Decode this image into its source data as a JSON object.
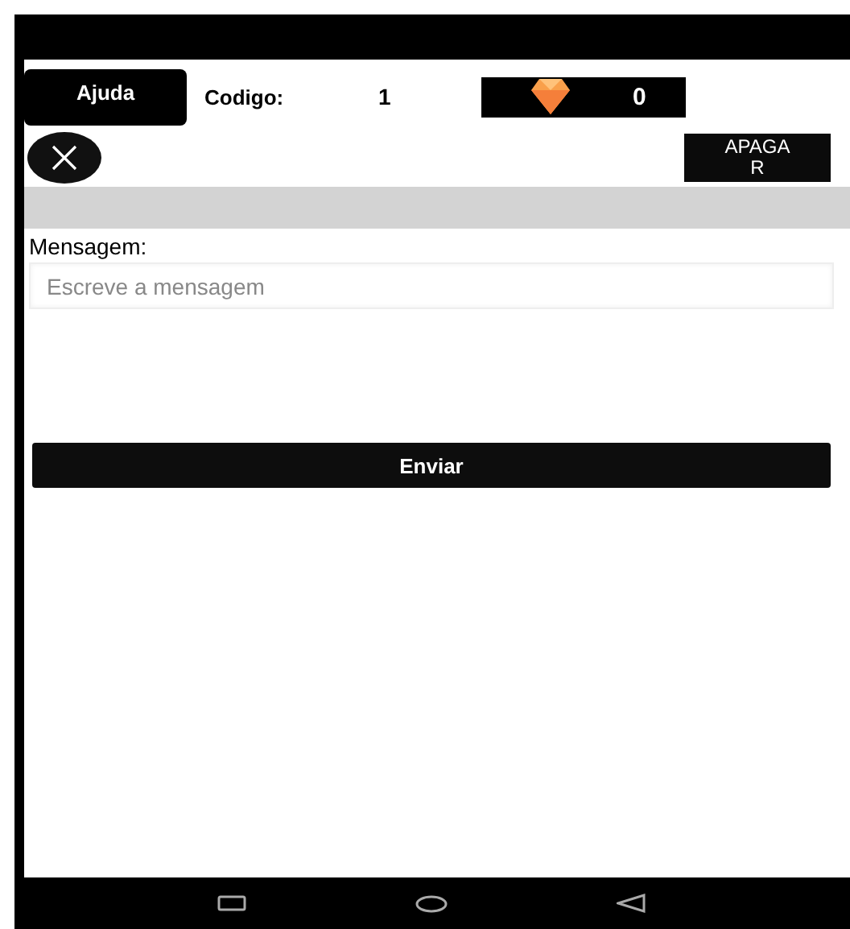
{
  "header": {
    "help_button": "Ajuda",
    "code_label": "Codigo:",
    "code_value": "1",
    "gems": "0"
  },
  "clear_button": "APAGAR",
  "message": {
    "label": "Mensagem:",
    "placeholder": "Escreve a mensagem"
  },
  "send_button": "Enviar"
}
